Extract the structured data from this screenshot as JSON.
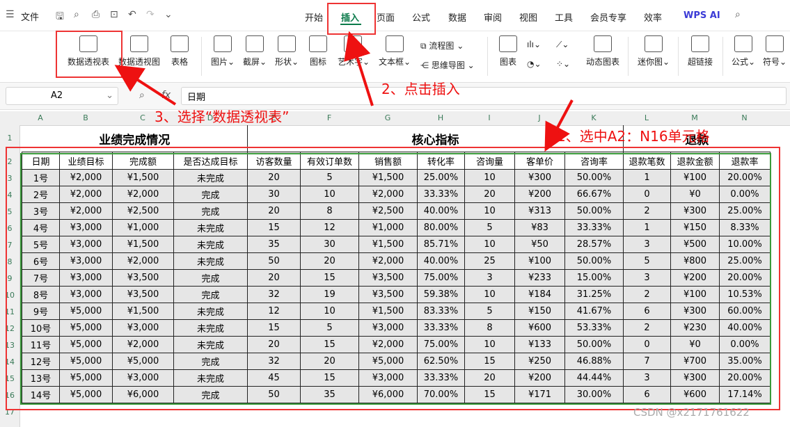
{
  "menubar": {
    "file_label": "文件",
    "tabs": [
      "开始",
      "插入",
      "页面",
      "公式",
      "数据",
      "审阅",
      "视图",
      "工具",
      "会员专享",
      "效率"
    ],
    "active_tab": "插入",
    "wps_ai_label": "WPS AI"
  },
  "ribbon": {
    "pivot_table": "数据透视表",
    "pivot_chart": "数据透视图",
    "table": "表格",
    "picture": "图片",
    "screenshot": "截屏",
    "shape": "形状",
    "icon": "图标",
    "art_text": "艺术字",
    "textbox": "文本框",
    "flowchart": "流程图",
    "mindmap": "思维导图",
    "chart": "图表",
    "dynamic_chart": "动态图表",
    "sparkline": "迷你图",
    "hyperlink": "超链接",
    "formula": "公式",
    "symbol": "符号"
  },
  "formula_bar": {
    "cell_ref": "A2",
    "fx_label": "fx",
    "content": "日期"
  },
  "columns": [
    "A",
    "B",
    "C",
    "D",
    "E",
    "F",
    "G",
    "H",
    "I",
    "J",
    "K",
    "L",
    "M",
    "N"
  ],
  "rows": [
    "1",
    "2",
    "3",
    "4",
    "5",
    "6",
    "7",
    "8",
    "9",
    "10",
    "11",
    "12",
    "13",
    "14",
    "15",
    "16",
    "17"
  ],
  "sheet": {
    "title_left": "业绩完成情况",
    "title_mid": "核心指标",
    "title_right": "退款",
    "headers": [
      "日期",
      "业绩目标",
      "完成额",
      "是否达成目标",
      "访客数量",
      "有效订单数",
      "销售额",
      "转化率",
      "咨询量",
      "客单价",
      "咨询率",
      "退款笔数",
      "退款金额",
      "退款率"
    ],
    "rows": [
      [
        "1号",
        "¥2,000",
        "¥1,500",
        "未完成",
        "20",
        "5",
        "¥1,500",
        "25.00%",
        "10",
        "¥300",
        "50.00%",
        "1",
        "¥100",
        "20.00%"
      ],
      [
        "2号",
        "¥2,000",
        "¥2,000",
        "完成",
        "30",
        "10",
        "¥2,000",
        "33.33%",
        "20",
        "¥200",
        "66.67%",
        "0",
        "¥0",
        "0.00%"
      ],
      [
        "3号",
        "¥2,000",
        "¥2,500",
        "完成",
        "20",
        "8",
        "¥2,500",
        "40.00%",
        "10",
        "¥313",
        "50.00%",
        "2",
        "¥300",
        "25.00%"
      ],
      [
        "4号",
        "¥3,000",
        "¥1,000",
        "未完成",
        "15",
        "12",
        "¥1,000",
        "80.00%",
        "5",
        "¥83",
        "33.33%",
        "1",
        "¥150",
        "8.33%"
      ],
      [
        "5号",
        "¥3,000",
        "¥1,500",
        "未完成",
        "35",
        "30",
        "¥1,500",
        "85.71%",
        "10",
        "¥50",
        "28.57%",
        "3",
        "¥500",
        "10.00%"
      ],
      [
        "6号",
        "¥3,000",
        "¥2,000",
        "未完成",
        "50",
        "20",
        "¥2,000",
        "40.00%",
        "25",
        "¥100",
        "50.00%",
        "5",
        "¥800",
        "25.00%"
      ],
      [
        "7号",
        "¥3,000",
        "¥3,500",
        "完成",
        "20",
        "15",
        "¥3,500",
        "75.00%",
        "3",
        "¥233",
        "15.00%",
        "3",
        "¥200",
        "20.00%"
      ],
      [
        "8号",
        "¥3,000",
        "¥3,500",
        "完成",
        "32",
        "19",
        "¥3,500",
        "59.38%",
        "10",
        "¥184",
        "31.25%",
        "2",
        "¥100",
        "10.53%"
      ],
      [
        "9号",
        "¥5,000",
        "¥1,500",
        "未完成",
        "12",
        "10",
        "¥1,500",
        "83.33%",
        "5",
        "¥150",
        "41.67%",
        "6",
        "¥300",
        "60.00%"
      ],
      [
        "10号",
        "¥5,000",
        "¥3,000",
        "未完成",
        "15",
        "5",
        "¥3,000",
        "33.33%",
        "8",
        "¥600",
        "53.33%",
        "2",
        "¥230",
        "40.00%"
      ],
      [
        "11号",
        "¥5,000",
        "¥2,000",
        "未完成",
        "20",
        "15",
        "¥2,000",
        "75.00%",
        "10",
        "¥133",
        "50.00%",
        "0",
        "¥0",
        "0.00%"
      ],
      [
        "12号",
        "¥5,000",
        "¥5,000",
        "完成",
        "32",
        "20",
        "¥5,000",
        "62.50%",
        "15",
        "¥250",
        "46.88%",
        "7",
        "¥700",
        "35.00%"
      ],
      [
        "13号",
        "¥5,000",
        "¥3,000",
        "未完成",
        "45",
        "15",
        "¥3,000",
        "33.33%",
        "20",
        "¥200",
        "44.44%",
        "3",
        "¥300",
        "20.00%"
      ],
      [
        "14号",
        "¥5,000",
        "¥6,000",
        "完成",
        "50",
        "35",
        "¥6,000",
        "70.00%",
        "15",
        "¥171",
        "30.00%",
        "6",
        "¥600",
        "17.14%"
      ]
    ]
  },
  "annotations": {
    "step1": "1、选中A2：N16单元格",
    "step2": "2、点击插入",
    "step3": "3、选择“数据透视表”"
  },
  "watermark": "CSDN @x2171761622"
}
